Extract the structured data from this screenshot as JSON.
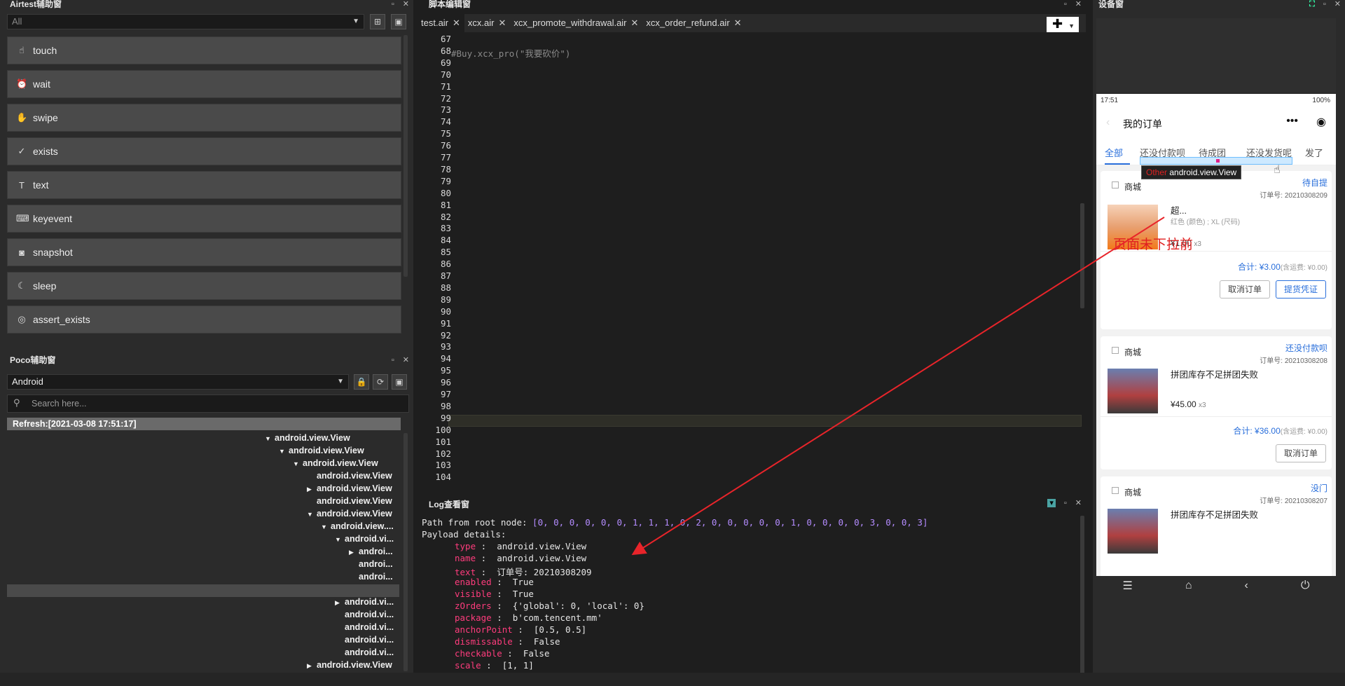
{
  "airtest": {
    "title": "Airtest辅助窗",
    "filter_placeholder": "All",
    "apis": [
      {
        "label": "touch",
        "icon": "touch-icon",
        "glyph": "☝"
      },
      {
        "label": "wait",
        "icon": "clock-icon",
        "glyph": "⏰"
      },
      {
        "label": "swipe",
        "icon": "swipe-icon",
        "glyph": "✋"
      },
      {
        "label": "exists",
        "icon": "check-circle-icon",
        "glyph": "✓"
      },
      {
        "label": "text",
        "icon": "text-icon",
        "glyph": "T"
      },
      {
        "label": "keyevent",
        "icon": "keyboard-icon",
        "glyph": "⌨"
      },
      {
        "label": "snapshot",
        "icon": "camera-icon",
        "glyph": "◙"
      },
      {
        "label": "sleep",
        "icon": "moon-icon",
        "glyph": "☾"
      },
      {
        "label": "assert_exists",
        "icon": "target-icon",
        "glyph": "◎"
      }
    ]
  },
  "poco": {
    "title": "Poco辅助窗",
    "platform": "Android",
    "search_placeholder": "Search here...",
    "refresh": "Refresh:[2021-03-08 17:51:17]",
    "tree": [
      {
        "arrow": "▼",
        "label": "android.view.View"
      },
      {
        "arrow": "▼",
        "label": "android.view.View"
      },
      {
        "arrow": "▼",
        "label": "android.view.View"
      },
      {
        "arrow": "",
        "label": "android.view.View"
      },
      {
        "arrow": "▶",
        "label": "android.view.View"
      },
      {
        "arrow": "",
        "label": "android.view.View"
      },
      {
        "arrow": "▼",
        "label": "android.view.View"
      },
      {
        "arrow": "▼",
        "label": "android.view...."
      },
      {
        "arrow": "▼",
        "label": "android.vi..."
      },
      {
        "arrow": "▶",
        "label": "androi..."
      },
      {
        "arrow": "",
        "label": "androi..."
      },
      {
        "arrow": "",
        "label": "androi..."
      },
      {
        "arrow": "",
        "label": "androi..."
      },
      {
        "arrow": "▶",
        "label": "android.vi..."
      },
      {
        "arrow": "",
        "label": "android.vi..."
      },
      {
        "arrow": "",
        "label": "android.vi..."
      },
      {
        "arrow": "",
        "label": "android.vi..."
      },
      {
        "arrow": "",
        "label": "android.vi..."
      },
      {
        "arrow": "▶",
        "label": "android.view.View"
      }
    ]
  },
  "editor": {
    "title": "脚本编辑窗",
    "tabs": [
      {
        "label": "test.air",
        "active": true
      },
      {
        "label": "xcx.air",
        "active": false
      },
      {
        "label": "xcx_promote_withdrawal.air",
        "active": false
      },
      {
        "label": "xcx_order_refund.air",
        "active": false
      }
    ],
    "first_line": 67,
    "last_line": 104,
    "code": "#Buy.xcx_pro(\"我要砍价\")"
  },
  "log": {
    "title": "Log查看窗",
    "path_label": "Path from root node: ",
    "path": "[0, 0, 0, 0, 0, 0, 1, 1, 1, 0, 2, 0, 0, 0, 0, 0, 1, 0, 0, 0, 0, 3, 0, 0, 3]",
    "payload_label": "Payload details:",
    "details": [
      {
        "key": "type",
        "value": "android.view.View"
      },
      {
        "key": "name",
        "value": "android.view.View"
      },
      {
        "key": "text",
        "value": "订单号: 20210308209"
      },
      {
        "key": "enabled",
        "value": "True"
      },
      {
        "key": "visible",
        "value": "True"
      },
      {
        "key": "zOrders",
        "value": "{'global': 0, 'local': 0}"
      },
      {
        "key": "package",
        "value": "b'com.tencent.mm'"
      },
      {
        "key": "anchorPoint",
        "value": "[0.5, 0.5]"
      },
      {
        "key": "dismissable",
        "value": "False"
      },
      {
        "key": "checkable",
        "value": "False"
      },
      {
        "key": "scale",
        "value": "[1, 1]"
      }
    ]
  },
  "device": {
    "title": "设备窗",
    "status_time": "17:51",
    "status_right": "100%",
    "page_title": "我的订单",
    "categories": [
      "全部",
      "还没付款呗",
      "待成团",
      "还没发货呢",
      "发了"
    ],
    "annotation": "页面未下拉前",
    "tooltip_prefix": "Other",
    "tooltip": "android.view.View",
    "orders": [
      {
        "shop": "商城",
        "status": "待自提",
        "order_no": "订单号: 20210308209",
        "title": "超...",
        "spec": "红色 (颜色) ; XL (尺码)",
        "price": "¥1.00",
        "qty": "x3",
        "total": "合计: ¥3.00",
        "shipping": "(含运费: ¥0.00)",
        "buttons": [
          "取消订单",
          "提货凭证"
        ]
      },
      {
        "shop": "商城",
        "status": "还没付款呗",
        "order_no": "订单号: 20210308208",
        "title": "拼团库存不足拼团失败",
        "spec": "",
        "price": "¥45.00",
        "qty": "x3",
        "total": "合计: ¥36.00",
        "shipping": "(含运费: ¥0.00)",
        "buttons": [
          "取消订单"
        ]
      },
      {
        "shop": "商城",
        "status": "没门",
        "order_no": "订单号: 20210308207",
        "title": "拼团库存不足拼团失败",
        "spec": "",
        "price": "",
        "qty": "",
        "total": "",
        "shipping": "",
        "buttons": []
      }
    ]
  }
}
